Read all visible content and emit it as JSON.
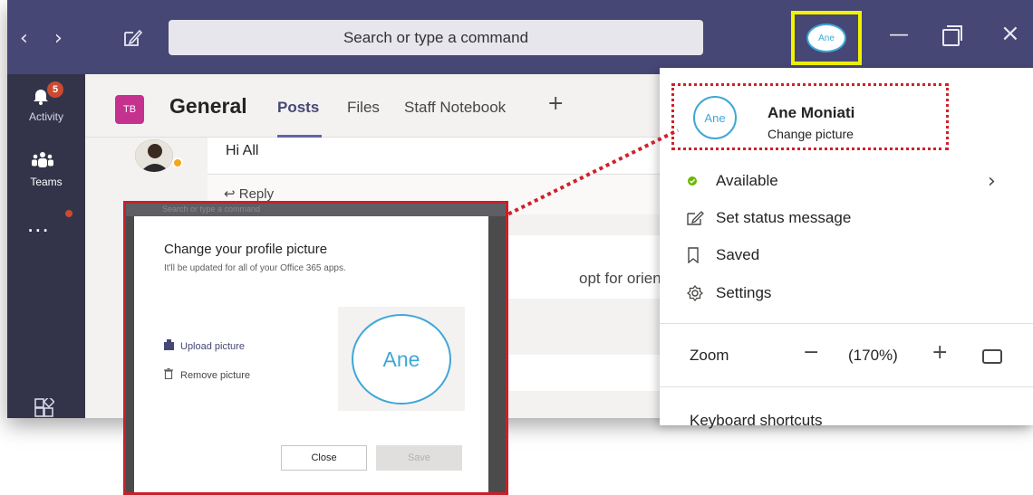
{
  "titlebar": {
    "back_glyph": "‹",
    "forward_glyph": "›",
    "search_placeholder": "Search or type a command",
    "avatar_initials": "Ane",
    "minimize_glyph": "—",
    "close_glyph": "×",
    "highlight_color": "#f2f200"
  },
  "rail": {
    "activity_label": "Activity",
    "activity_badge": "5",
    "teams_label": "Teams",
    "more_glyph": "..."
  },
  "channel": {
    "team_tile": "TB",
    "title": "General",
    "tabs": [
      "Posts",
      "Files",
      "Staff Notebook"
    ],
    "add_tab_glyph": "+"
  },
  "post": {
    "text": "Hi All",
    "reply_label": "Reply",
    "reply_glyph": "↩",
    "snippet": "opt for orientation i"
  },
  "profile_menu": {
    "avatar_initials": "Ane",
    "name": "Ane Moniati",
    "change_picture": "Change picture",
    "items": [
      {
        "icon": "status-dot-icon",
        "label": "Available"
      },
      {
        "icon": "edit-status-icon",
        "label": "Set status message"
      },
      {
        "icon": "bookmark-icon",
        "label": "Saved"
      },
      {
        "icon": "gear-icon",
        "label": "Settings"
      }
    ],
    "zoom_label": "Zoom",
    "zoom_minus": "−",
    "zoom_value": "(170%)",
    "zoom_plus": "+",
    "keyboard_shortcuts": "Keyboard shortcuts",
    "highlight_color": "#d1202a"
  },
  "dialog": {
    "topstrip_text": "Search or type a command",
    "title": "Change your profile picture",
    "subtitle": "It'll be updated for all of your Office 365 apps.",
    "upload_label": "Upload picture",
    "remove_label": "Remove picture",
    "avatar_initials": "Ane",
    "close_label": "Close",
    "save_label": "Save",
    "frame_color": "#c8202a"
  },
  "colors": {
    "titlebar": "#464775",
    "rail": "#33344a",
    "accent": "#6264a7",
    "avatar_ring": "#3fa7d6",
    "available": "#6bb700"
  }
}
